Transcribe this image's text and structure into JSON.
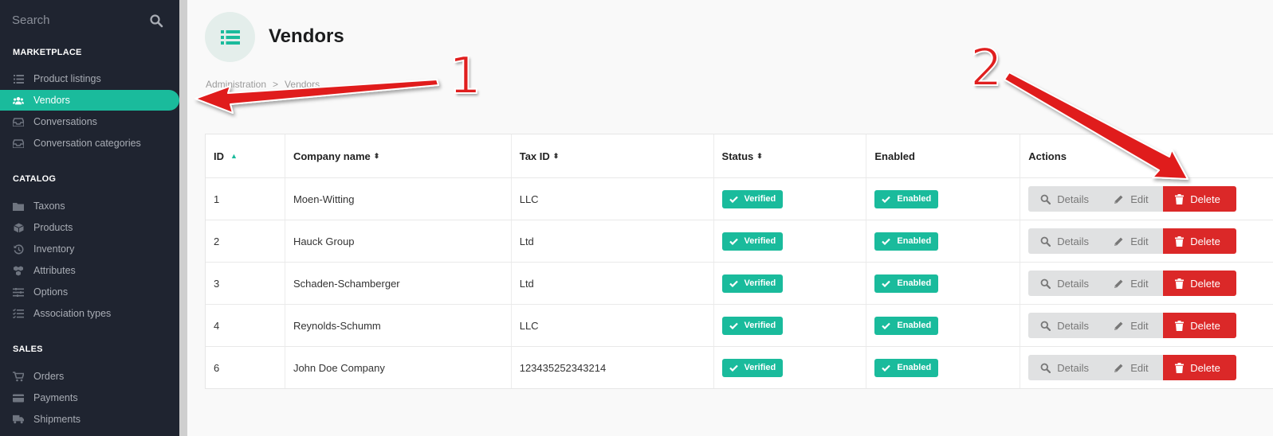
{
  "sidebar": {
    "search_placeholder": "Search",
    "sections": [
      {
        "title": "MARKETPLACE",
        "items": [
          {
            "label": "Product listings",
            "icon": "list-icon"
          },
          {
            "label": "Vendors",
            "icon": "users-icon",
            "active": true
          },
          {
            "label": "Conversations",
            "icon": "inbox-icon"
          },
          {
            "label": "Conversation categories",
            "icon": "inbox-icon"
          }
        ]
      },
      {
        "title": "CATALOG",
        "items": [
          {
            "label": "Taxons",
            "icon": "folder-icon"
          },
          {
            "label": "Products",
            "icon": "cube-icon"
          },
          {
            "label": "Inventory",
            "icon": "history-icon"
          },
          {
            "label": "Attributes",
            "icon": "cubes-icon"
          },
          {
            "label": "Options",
            "icon": "options-icon"
          },
          {
            "label": "Association types",
            "icon": "tasks-icon"
          }
        ]
      },
      {
        "title": "SALES",
        "items": [
          {
            "label": "Orders",
            "icon": "cart-icon"
          },
          {
            "label": "Payments",
            "icon": "credit-card-icon"
          },
          {
            "label": "Shipments",
            "icon": "truck-icon"
          }
        ]
      }
    ]
  },
  "header": {
    "title": "Vendors",
    "breadcrumb": [
      "Administration",
      "Vendors"
    ]
  },
  "table": {
    "columns": [
      "ID",
      "Company name",
      "Tax ID",
      "Status",
      "Enabled",
      "Actions"
    ],
    "rows": [
      {
        "id": "1",
        "name": "Moen-Witting",
        "tax": "LLC",
        "status": "Verified",
        "enabled": "Enabled"
      },
      {
        "id": "2",
        "name": "Hauck Group",
        "tax": "Ltd",
        "status": "Verified",
        "enabled": "Enabled"
      },
      {
        "id": "3",
        "name": "Schaden-Schamberger",
        "tax": "Ltd",
        "status": "Verified",
        "enabled": "Enabled"
      },
      {
        "id": "4",
        "name": "Reynolds-Schumm",
        "tax": "LLC",
        "status": "Verified",
        "enabled": "Enabled"
      },
      {
        "id": "6",
        "name": "John Doe Company",
        "tax": "123435252343214",
        "status": "Verified",
        "enabled": "Enabled"
      }
    ],
    "actions": {
      "details": "Details",
      "edit": "Edit",
      "delete": "Delete"
    }
  },
  "annotations": {
    "first": "1",
    "second": "2"
  },
  "colors": {
    "accent": "#1abb9c",
    "danger": "#db2828",
    "sidebar_bg": "#1f2430",
    "annotation_red": "#e01f1f"
  }
}
